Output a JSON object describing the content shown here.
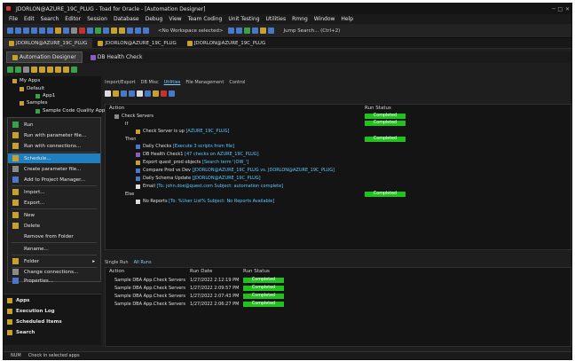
{
  "app": {
    "title": "JDORLON@AZURE_19C_PLUG - Toad for Oracle - [Automation Designer]"
  },
  "menu": [
    "File",
    "Edit",
    "Search",
    "Editor",
    "Session",
    "Database",
    "Debug",
    "View",
    "Team Coding",
    "Unit Testing",
    "Utilities",
    "Rmng",
    "Window",
    "Help"
  ],
  "toolbar": {
    "workspace_select": "<No Workspace selected>",
    "jump_search": "Jump Search... (Ctrl+2)"
  },
  "connection_tabs": [
    "JDORLON@AZURE_19C_PLUG",
    "JDORLON@AZURE_19C_PLUG",
    "JDORLON@AZURE_19C_PLUG"
  ],
  "document_tabs": [
    "Automation Designer",
    "DB Health Check"
  ],
  "tree": {
    "my_apps": "My Apps",
    "default": "Default",
    "app1": "App1",
    "samples": "Samples",
    "sample_code_quality": "Sample Code Quality App"
  },
  "context_menu": {
    "run": "Run",
    "run_with_params": "Run with parameter file...",
    "run_with_connections": "Run with connections...",
    "schedule": "Schedule...",
    "create_param_file": "Create parameter file...",
    "add_to_project_manager": "Add to Project Manager...",
    "import": "Import...",
    "export": "Export...",
    "new": "New",
    "delete": "Delete",
    "remove_from_folder": "Remove from Folder",
    "rename": "Rename...",
    "folder": "Folder",
    "change_connections": "Change connections...",
    "properties": "Properties..."
  },
  "bottom_nav": [
    "Apps",
    "Execution Log",
    "Scheduled Items",
    "Search"
  ],
  "sub_tabs": [
    "Import/Export",
    "DB Misc",
    "Utilities",
    "File Management",
    "Control"
  ],
  "grid": {
    "col_action": "Action",
    "col_run_status": "Run Status",
    "rows": {
      "check_servers": "Check Servers",
      "if": "If",
      "check_server_up": "Check Server is up",
      "check_server_up_detail": "[AZURE_19C_PLUG]",
      "then": "Then",
      "daily_checks": "Daily Checks",
      "daily_checks_detail": "[Execute 3 scripts from file]",
      "db_health": "DB Health Check1",
      "db_health_detail": "[47 checks on AZURE_19C_PLUG]",
      "export_quest": "Export quest_prod objects",
      "export_quest_detail": "[Search term '(OW_']",
      "compare": "Compare Prod vs Dev",
      "compare_detail": "[JDORLON@AZURE_19C_PLUG vs. JDORLON@AZURE_19C_PLUG]",
      "daily_schema": "Daily Schema Update",
      "daily_schema_detail": "[JDORLON@AZURE_19C_PLUG]",
      "email": "Email",
      "email_detail": "[To: john.doe@quest.com Subject: automation complete]",
      "else": "Else",
      "no_reports": "No Reports",
      "no_reports_detail": "[To: %User List% Subject: No Reports Available]"
    },
    "status": {
      "completed": "Completed"
    }
  },
  "bottom_tabs": [
    "Single Run",
    "All Runs"
  ],
  "bottom_grid": {
    "col_action": "Action",
    "col_run_date": "Run Date",
    "col_run_status": "Run Status",
    "rows": [
      {
        "action": "Sample DBA App.Check Servers",
        "date": "1/27/2022 2:12:19 PM",
        "status": "Completed"
      },
      {
        "action": "Sample DBA App.Check Servers",
        "date": "1/27/2022 2:09:57 PM",
        "status": "Completed"
      },
      {
        "action": "Sample DBA App.Check Servers",
        "date": "1/27/2022 2:07:43 PM",
        "status": "Completed"
      },
      {
        "action": "Sample DBA App.Check Servers",
        "date": "1/27/2022 2:06:27 PM",
        "status": "Completed"
      }
    ]
  },
  "statusbar": {
    "mode": "NUM",
    "message": "Check in selected apps"
  },
  "colors": {
    "accent": "#1f7fbf",
    "completed": "#22c21e",
    "link": "#5ec8ff"
  }
}
